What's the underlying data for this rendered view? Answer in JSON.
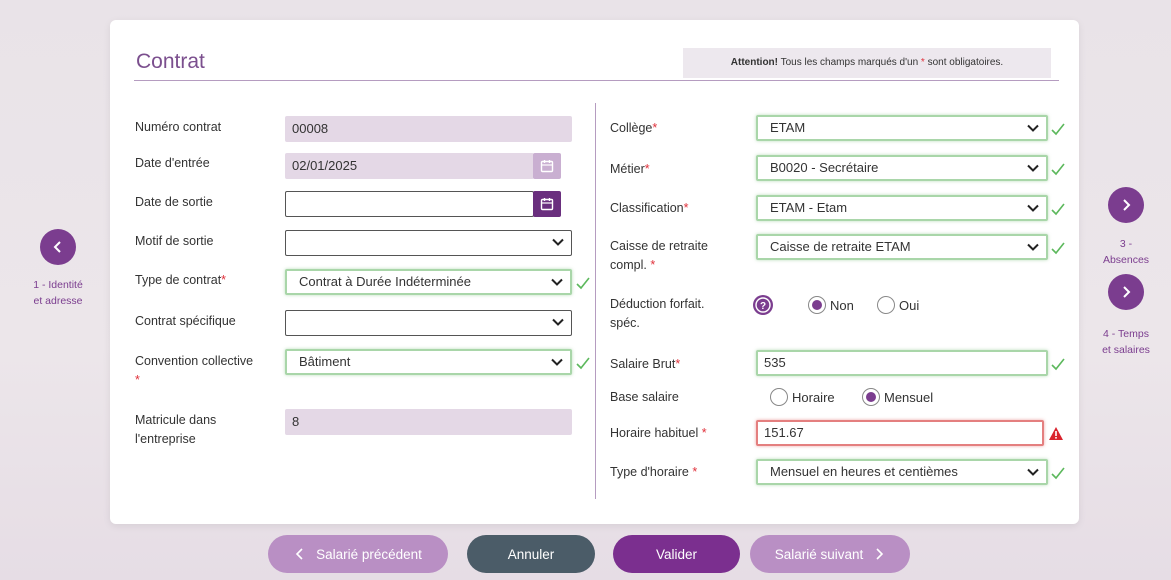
{
  "header": {
    "title": "Contrat",
    "attention_strong": "Attention!",
    "attention_text_before": " Tous les champs marqués d'un ",
    "attention_star": "*",
    "attention_text_after": " sont obligatoires."
  },
  "left": {
    "numero_contrat": {
      "label": "Numéro contrat",
      "value": "00008"
    },
    "date_entree": {
      "label": "Date d'entrée",
      "value": "02/01/2025"
    },
    "date_sortie": {
      "label": "Date de sortie",
      "value": ""
    },
    "motif_sortie": {
      "label": "Motif de sortie",
      "value": ""
    },
    "type_contrat": {
      "label": "Type de contrat",
      "value": "Contrat à Durée Indéterminée"
    },
    "contrat_specifique": {
      "label": "Contrat spécifique",
      "value": ""
    },
    "convention": {
      "label": "Convention collective",
      "value": "Bâtiment"
    },
    "matricule": {
      "label_line1": "Matricule dans",
      "label_line2": "l'entreprise",
      "value": "8"
    }
  },
  "right": {
    "college": {
      "label": "Collège",
      "value": "ETAM"
    },
    "metier": {
      "label": "Métier",
      "value": "B0020 - Secrétaire"
    },
    "classification": {
      "label": "Classification",
      "value": "ETAM - Etam"
    },
    "caisse": {
      "label_line1": "Caisse de retraite",
      "label_line2": "compl.",
      "value": "Caisse de retraite ETAM"
    },
    "deduction": {
      "label_line1": "Déduction forfait.",
      "label_line2": "spéc.",
      "option_no": "Non",
      "option_yes": "Oui",
      "selected": "Non"
    },
    "salaire_brut": {
      "label": "Salaire Brut",
      "value": "535"
    },
    "base_salaire": {
      "label": "Base salaire",
      "option_1": "Horaire",
      "option_2": "Mensuel",
      "selected": "Mensuel"
    },
    "horaire_habituel": {
      "label": "Horaire habituel",
      "value": "151.67"
    },
    "type_horaire": {
      "label": "Type d'horaire",
      "value": "Mensuel en heures et centièmes"
    }
  },
  "nav": {
    "prev_label_1": "1 - Identité",
    "prev_label_2": "et adresse",
    "next1_label_1": "3 -",
    "next1_label_2": "Absences",
    "next2_label_1": "4 - Temps",
    "next2_label_2": "et salaires"
  },
  "footer": {
    "prev_employee": "Salarié précédent",
    "cancel": "Annuler",
    "validate": "Valider",
    "next_employee": "Salarié suivant"
  },
  "colors": {
    "accent": "#7b3d8f",
    "valid_border": "#a9d6a9",
    "invalid_border": "#e47f7f",
    "required_star": "#e0303a"
  }
}
